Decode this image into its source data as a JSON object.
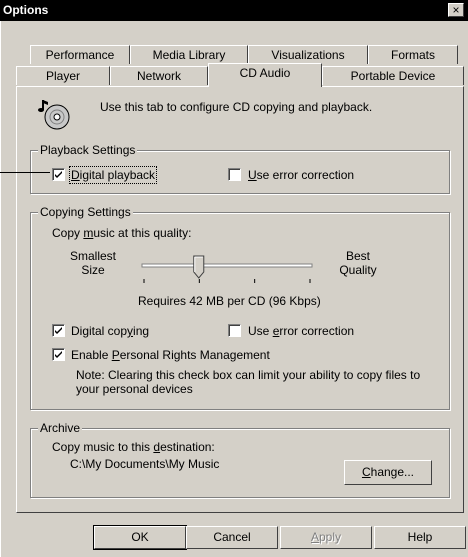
{
  "window": {
    "title": "Options",
    "close_glyph": "×"
  },
  "tabs_back": [
    "Performance",
    "Media Library",
    "Visualizations",
    "Formats"
  ],
  "tabs_front": [
    "Player",
    "Network",
    "CD Audio",
    "Portable Device"
  ],
  "active_tab": "CD Audio",
  "intro": {
    "icon": "cd-audio-icon",
    "text": "Use this tab to configure CD copying and playback."
  },
  "playback": {
    "legend": "Playback Settings",
    "digital_playback": {
      "label": "Digital playback",
      "checked": true
    },
    "use_error_correction": {
      "label": "Use error correction",
      "checked": false
    }
  },
  "copying": {
    "legend": "Copying Settings",
    "quality_label": "Copy music at this quality:",
    "smallest_line1": "Smallest",
    "smallest_line2": "Size",
    "best_line1": "Best",
    "best_line2": "Quality",
    "slider_level": 0.33,
    "requirement": "Requires 42 MB per CD (96 Kbps)",
    "digital_copying": {
      "label": "Digital copying",
      "checked": true
    },
    "use_error_correction": {
      "label": "Use error correction",
      "checked": false
    },
    "rights_management": {
      "label": "Enable Personal Rights Management",
      "checked": true
    },
    "note": "Note: Clearing this check box can limit your ability to copy files to your personal devices"
  },
  "archive": {
    "legend": "Archive",
    "destination_label": "Copy music to this destination:",
    "path": "C:\\My Documents\\My Music",
    "change_button": "Change..."
  },
  "buttons": {
    "ok": "OK",
    "cancel": "Cancel",
    "apply": "Apply",
    "help": "Help"
  }
}
